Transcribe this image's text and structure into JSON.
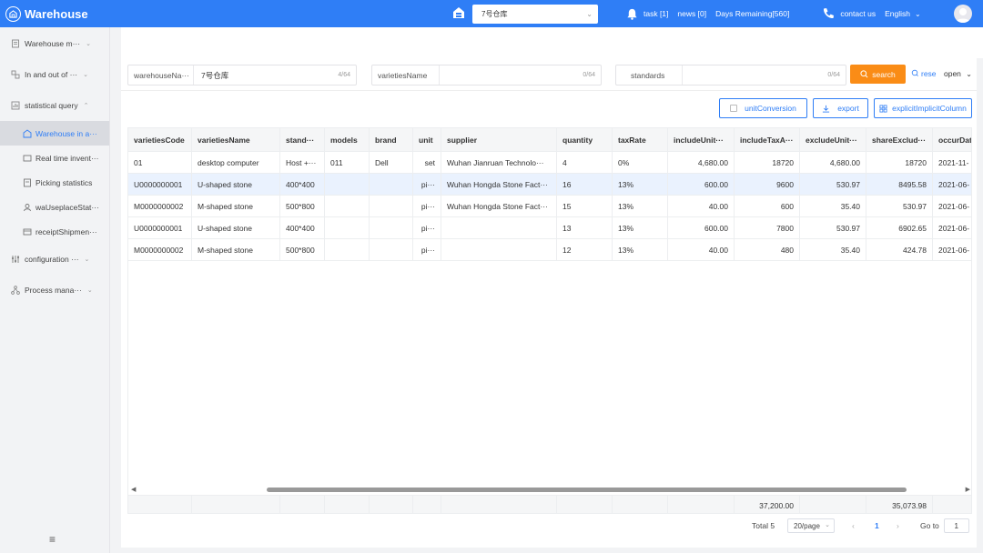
{
  "header": {
    "app_title": "Warehouse",
    "warehouse_selected": "7号仓库",
    "task": "task [1]",
    "news": "news [0]",
    "days_remaining": "Days Remaining[560]",
    "contact": "contact us",
    "language": "English",
    "accent": "#2f7ef6"
  },
  "sidebar": {
    "items": [
      {
        "label": "Warehouse m···",
        "icon": "document-icon"
      },
      {
        "label": "In and out of ···",
        "icon": "transfer-icon"
      },
      {
        "label": "statistical query",
        "icon": "chart-icon"
      }
    ],
    "subitems": [
      {
        "label": "Warehouse in a···",
        "active": true
      },
      {
        "label": "Real time invent···",
        "active": false
      },
      {
        "label": "Picking statistics",
        "active": false
      },
      {
        "label": "waUseplaceStat···",
        "active": false
      },
      {
        "label": "receiptShipmen···",
        "active": false
      }
    ],
    "bottom_items": [
      {
        "label": "configuration ···",
        "icon": "settings-icon"
      },
      {
        "label": "Process mana···",
        "icon": "process-icon"
      }
    ]
  },
  "filters": {
    "warehouse_label": "warehouseNa···",
    "warehouse_value": "7号仓库",
    "warehouse_count": "4/64",
    "varieties_label": "varietiesName",
    "varieties_count": "0/64",
    "standards_label": "standards",
    "standards_count": "0/64",
    "search": "search",
    "reset": "rese",
    "open": "open"
  },
  "toolbar": {
    "unit_conversion": "unitConversion",
    "export": "export",
    "columns": "explicitImplicitColumn"
  },
  "table": {
    "columns": [
      "varietiesCode",
      "varietiesName",
      "stand···",
      "models",
      "brand",
      "unit",
      "supplier",
      "quantity",
      "taxRate",
      "includeUnit···",
      "includeTaxA···",
      "excludeUnit···",
      "shareExclud···",
      "occurDat"
    ],
    "rows": [
      [
        "01",
        "desktop computer",
        "Host +···",
        "011",
        "Dell",
        "set",
        "Wuhan Jianruan Technolo···",
        "4",
        "0%",
        "4,680.00",
        "18720",
        "4,680.00",
        "18720",
        "2021-11-"
      ],
      [
        "U0000000001",
        "U-shaped stone",
        "400*400",
        "",
        "",
        "pi···",
        "Wuhan Hongda Stone Fact···",
        "16",
        "13%",
        "600.00",
        "9600",
        "530.97",
        "8495.58",
        "2021-06-"
      ],
      [
        "M0000000002",
        "M-shaped stone",
        "500*800",
        "",
        "",
        "pi···",
        "Wuhan Hongda Stone Fact···",
        "15",
        "13%",
        "40.00",
        "600",
        "35.40",
        "530.97",
        "2021-06-"
      ],
      [
        "U0000000001",
        "U-shaped stone",
        "400*400",
        "",
        "",
        "pi···",
        "",
        "13",
        "13%",
        "600.00",
        "7800",
        "530.97",
        "6902.65",
        "2021-06-"
      ],
      [
        "M0000000002",
        "M-shaped stone",
        "500*800",
        "",
        "",
        "pi···",
        "",
        "12",
        "13%",
        "40.00",
        "480",
        "35.40",
        "424.78",
        "2021-06-"
      ]
    ],
    "sum_include_tax": "37,200.00",
    "sum_share_exclude": "35,073.98"
  },
  "pagination": {
    "total": "Total 5",
    "page_size": "20/page",
    "current_page": "1",
    "goto_label": "Go to",
    "goto_value": "1"
  }
}
